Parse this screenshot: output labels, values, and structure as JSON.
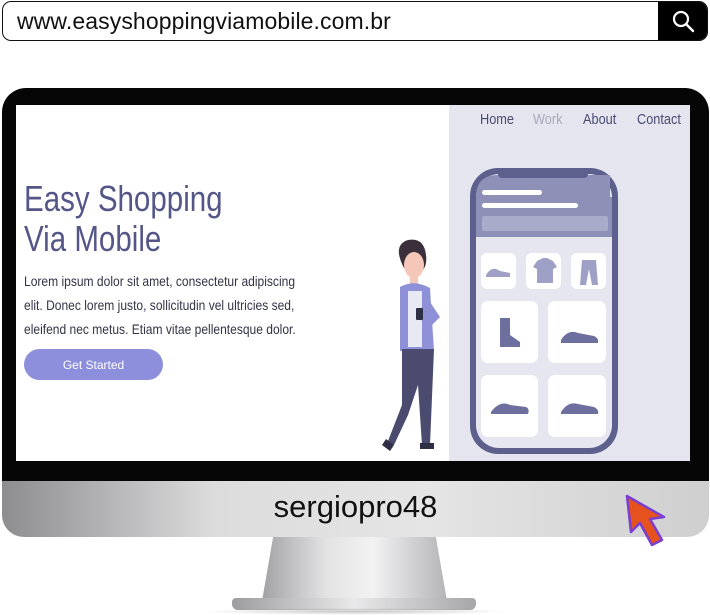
{
  "address_bar": {
    "url": "www.easyshoppingviamobile.com.br",
    "search_icon": "search-icon"
  },
  "monitor": {
    "brand_label": "sergiopro48"
  },
  "site": {
    "nav": [
      {
        "label": "Home",
        "active": false
      },
      {
        "label": "Work",
        "active": true
      },
      {
        "label": "About",
        "active": false
      },
      {
        "label": "Contact",
        "active": false
      }
    ],
    "hero": {
      "title_line1": "Easy Shopping",
      "title_line2": "Via Mobile",
      "body": "Lorem ipsum dolor sit amet, consectetur adipiscing elit. Donec lorem justo, sollicitudin vel ultricies sed, eleifend nec metus. Etiam vitae pellentesque dolor.",
      "cta_label": "Get Started"
    }
  },
  "colors": {
    "accent": "#8e8fdc",
    "title": "#545688",
    "panel": "#e5e5ef",
    "cursor": "#e6521e"
  },
  "icons": [
    "search-icon",
    "shoe-icon",
    "tshirt-icon",
    "pants-icon",
    "boot-icon",
    "sneaker-icon",
    "cursor-arrow-icon"
  ]
}
